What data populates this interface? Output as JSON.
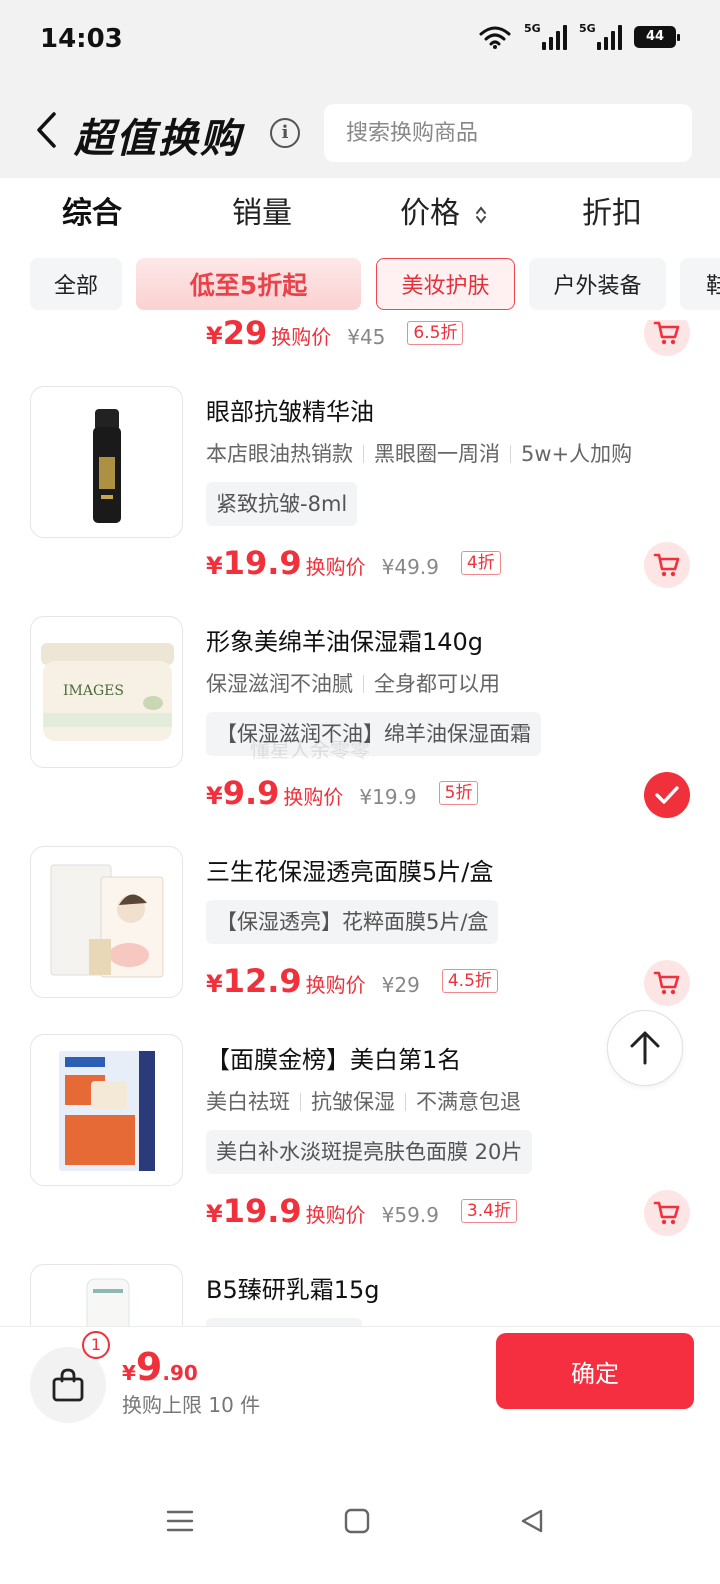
{
  "status_bar": {
    "time": "14:03",
    "network_1": "5G",
    "network_2": "5G",
    "battery": "44"
  },
  "header": {
    "title": "超值换购",
    "search_placeholder": "搜索换购商品"
  },
  "sort_tabs": [
    {
      "label": "综合",
      "active": true
    },
    {
      "label": "销量",
      "active": false
    },
    {
      "label": "价格",
      "active": false
    },
    {
      "label": "折扣",
      "active": false
    }
  ],
  "filter_chips": [
    {
      "label": "全部"
    },
    {
      "label": "低至5折起"
    },
    {
      "label": "美妆护肤",
      "selected": true
    },
    {
      "label": "户外装备"
    },
    {
      "label": "鞋"
    }
  ],
  "products": [
    {
      "name": "",
      "price_yen": "¥",
      "price": "29",
      "price_label": "换购价",
      "original_price": "¥45",
      "discount": "6.5折",
      "action": "cart-icon"
    },
    {
      "name": "眼部抗皱精华油",
      "tags": [
        "本店眼油热销款",
        "黑眼圈一周消",
        "5w+人加购"
      ],
      "spec": "紧致抗皱-8ml",
      "price_yen": "¥",
      "price": "19.9",
      "price_label": "换购价",
      "original_price": "¥49.9",
      "discount": "4折",
      "action": "cart-icon"
    },
    {
      "name": "形象美绵羊油保湿霜140g",
      "tags": [
        "保湿滋润不油腻",
        "全身都可以用"
      ],
      "spec": "【保湿滋润不油】绵羊油保湿面霜",
      "price_yen": "¥",
      "price": "9.9",
      "price_label": "换购价",
      "original_price": "¥19.9",
      "discount": "5折",
      "action": "check-icon",
      "thumb_brand": "IMAGES"
    },
    {
      "name": "三生花保湿透亮面膜5片/盒",
      "spec": "【保湿透亮】花粹面膜5片/盒",
      "price_yen": "¥",
      "price": "12.9",
      "price_label": "换购价",
      "original_price": "¥29",
      "discount": "4.5折",
      "action": "cart-icon"
    },
    {
      "name": "【面膜金榜】美白第1名",
      "tags": [
        "美白祛斑",
        "抗皱保湿",
        "不满意包退"
      ],
      "spec": "美白补水淡斑提亮肤色面膜 20片",
      "price_yen": "¥",
      "price": "19.9",
      "price_label": "换购价",
      "original_price": "¥59.9",
      "discount": "3.4折",
      "action": "cart-icon"
    },
    {
      "name": "B5臻研乳霜15g"
    }
  ],
  "watermark": "懂星人余零零",
  "bottom_bar": {
    "badge": "1",
    "yen": "¥",
    "price_int": "9",
    "price_dec": ".90",
    "limit_text": "换购上限 10 件",
    "confirm_label": "确定"
  },
  "colors": {
    "accent": "#f0303b",
    "confirm": "#f52f3f",
    "chip_bg": "#f4f5f7",
    "header_bg": "#f2f2f2"
  }
}
